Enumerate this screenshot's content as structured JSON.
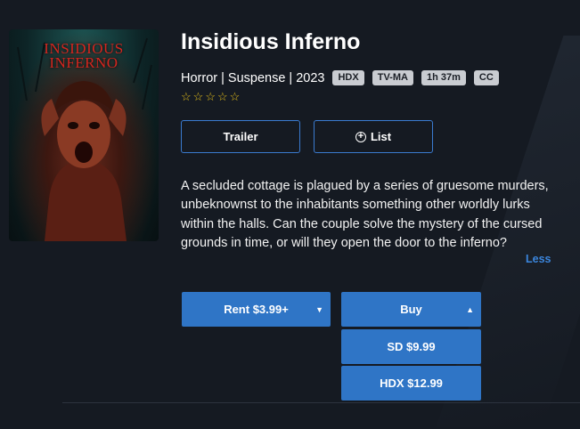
{
  "poster": {
    "title_line1": "INSIDIOUS",
    "title_line2": "INFERNO",
    "accent": "#d4261f"
  },
  "movie": {
    "title": "Insidious Inferno",
    "genres": "Horror | Suspense | 2023",
    "badges": [
      "HDX",
      "TV-MA",
      "1h 37m",
      "CC"
    ],
    "rating_stars": 0,
    "star_icon": "star-outline-icon",
    "description": "A secluded cottage is plagued by a series of gruesome murders, unbeknownst to the inhabitants something other worldly lurks within the halls. Can the couple solve the mystery of the cursed grounds in time, or will they open the door to the inferno?",
    "less_label": "Less"
  },
  "actions": {
    "trailer_label": "Trailer",
    "list_label": "List",
    "rent_label": "Rent $3.99+",
    "buy_label": "Buy",
    "buy_options": [
      "SD $9.99",
      "HDX $12.99"
    ]
  },
  "colors": {
    "accent": "#2f75c6",
    "link": "#3b86dd",
    "star": "#e8c21a",
    "background": "#151a22"
  }
}
